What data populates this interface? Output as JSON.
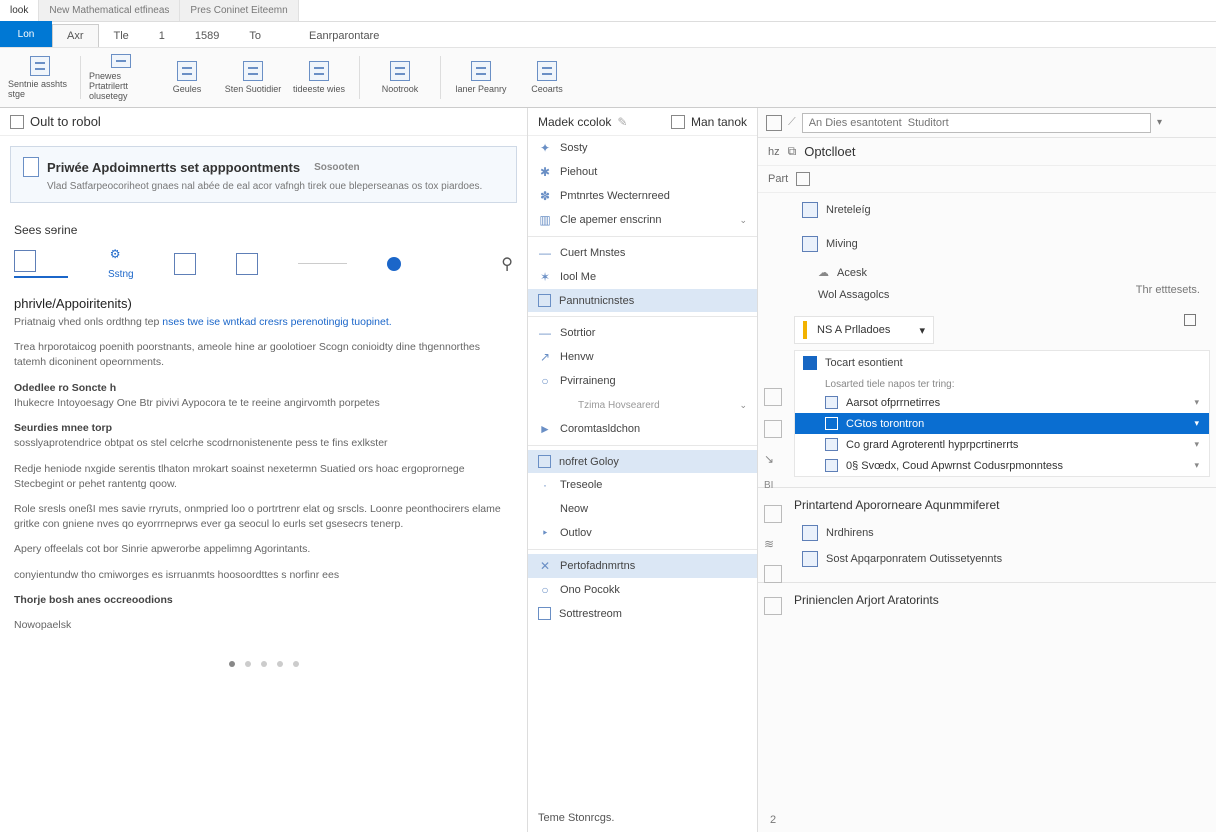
{
  "window_tabs": [
    "look",
    "New  Mathematical etfineas",
    "Pres Coninet Eiteemn"
  ],
  "ribbon": {
    "corner": "Lon",
    "tabs": [
      "Axr",
      "Tle",
      "1",
      "1589",
      "To",
      "Eanrparontare"
    ],
    "buttons": [
      "Sentnie asshts stge",
      "Pnewes Prtatrilertt olusetegy",
      "Geules",
      "Sten Suotidier",
      "tideeste wies",
      "Nootrook",
      "laner Peanry",
      "Ceoarts"
    ]
  },
  "left_pane": {
    "title": "Oult to robol",
    "card_title": "Priwée Apdoimnertts set apppoontments",
    "card_sub": "Sosooten",
    "card_note": "Vlad Satfarpeocoriheot gnaes nal abée de eal acor vafngh tirek oue bleperseanas os tox piardoes.",
    "sees": "Sees sɘrine",
    "setng": "Sstng",
    "h2": "phrivle/Appoiritenits)",
    "p1_a": "Priatnaig vhed onls ordthng tep ",
    "p1_link": "nses twe ise wntkad cresrs perenotingig tuopinet.",
    "p2": "Trea hrporotaicog poenith poorstnants, ameole hine ar goolotioer Scogn conioidty dine thgennorthes tatemh diconinent opeornments.",
    "p3_b": "Odedlee ro Soncte h",
    "p3": "Ihukecre Intoyoesagy One Btr pivivi Aypocora te te reeine angirvomth porpetes",
    "p4_b": "Seurdies mnee torp",
    "p4": "sosslyaprotendrice obtpat os stel celcrhe scodrnonistenente pess te fins exlkster",
    "p5": "Redje heniode nxgide serentis tlhaton mrokart soainst nexetermn Suatied ors hoac ergoprornege Stecbegint or pehet rantentg qoow.",
    "p6": "Role sresls oneßI mes savie rryruts, onmpried loo o portrtrenr elat og srscls. Loonre peonthocirers elame gritke con gniene nves qo eyorrrneprws ever ga seocul lo eurls set gsesecrs tenerp.",
    "p7": "Apery offeelals cot bor Sinrie apwerorbe appelimng Agorintants.",
    "p8": "conyientundw tho cmiworges es isrruanmts hoosoordttes s norfinr ees",
    "p9_b": "Thorje bosh anes occreoodions",
    "p10": "Nowopaelsk"
  },
  "mid_pane": {
    "title": "Madek ccolok",
    "title2": "Man tanok",
    "items": [
      {
        "label": "Sosty",
        "glyph": "✦"
      },
      {
        "label": "Piehout",
        "glyph": "✱"
      },
      {
        "label": "Pmtnrtes Wecternreed",
        "glyph": "✽"
      },
      {
        "label": "Cle apemer enscrinn",
        "glyph": "▥",
        "chev": true
      },
      {
        "type": "sep"
      },
      {
        "label": "Cuert Mnstes",
        "glyph": "—"
      },
      {
        "label": "Iool Me",
        "glyph": "✶"
      },
      {
        "label": "Pannutnicnstes",
        "box": true,
        "hover": true
      },
      {
        "type": "sep"
      },
      {
        "label": "Sotrtior",
        "glyph": "—"
      },
      {
        "label": "Henvw",
        "glyph": "↗"
      },
      {
        "label": "Pvirraineng",
        "glyph": "○"
      },
      {
        "label": "Tzima Hovsearerd",
        "sub": true,
        "chev": true
      },
      {
        "label": "Coromtasldchon",
        "glyph": "►"
      },
      {
        "type": "sep"
      },
      {
        "label": "nofret Goloy",
        "box": true,
        "hover": true
      },
      {
        "label": "Treseole",
        "glyph": "·"
      },
      {
        "label": "Neow",
        "glyph": ""
      },
      {
        "label": "Outlov",
        "glyph": "‣"
      },
      {
        "type": "sep"
      },
      {
        "label": "Pertofadnmrtns",
        "glyph": "✕",
        "hover": true
      },
      {
        "label": "Ono Pocokk",
        "glyph": "○"
      },
      {
        "label": "Sottrestreom",
        "box": true
      }
    ],
    "footer": "Teme Stonrcgs."
  },
  "right_pane": {
    "search_label": "An Dies esantotent  Studitort",
    "quick1_label": "hz",
    "quick1_text": "Optclloet",
    "quick2_label": "Part",
    "opt_nreteleg": "Nreteleíg",
    "opt_miving": "Miving",
    "opt_acesk": "Acesk",
    "opt_wol": "Wol Assagolcs",
    "right_label": "Thr etttesets.",
    "counter": "NS A Prlladoes",
    "chev_label": "▾",
    "list_head": "Tocart esontient",
    "list_sub": "Losarted tiele napos ter tring:",
    "list": [
      {
        "label": "Aarsot ofprrnetirres"
      },
      {
        "label": "CGtos torontron",
        "selected": true
      },
      {
        "label": "Co grard Agroterentl hyprpcrtinerrts"
      },
      {
        "label": "0§ Svœdx, Coud Apwrnst Codusrpmonntess"
      }
    ],
    "group1_title": "Printartend Apororneare Aqunmmiferet",
    "group1_items": [
      "Nrdhirens",
      "Sost Apqarponratem Outissetyennts"
    ],
    "group2_title": "Prinienclen Arjort Aratorints",
    "footer_num": "2"
  }
}
